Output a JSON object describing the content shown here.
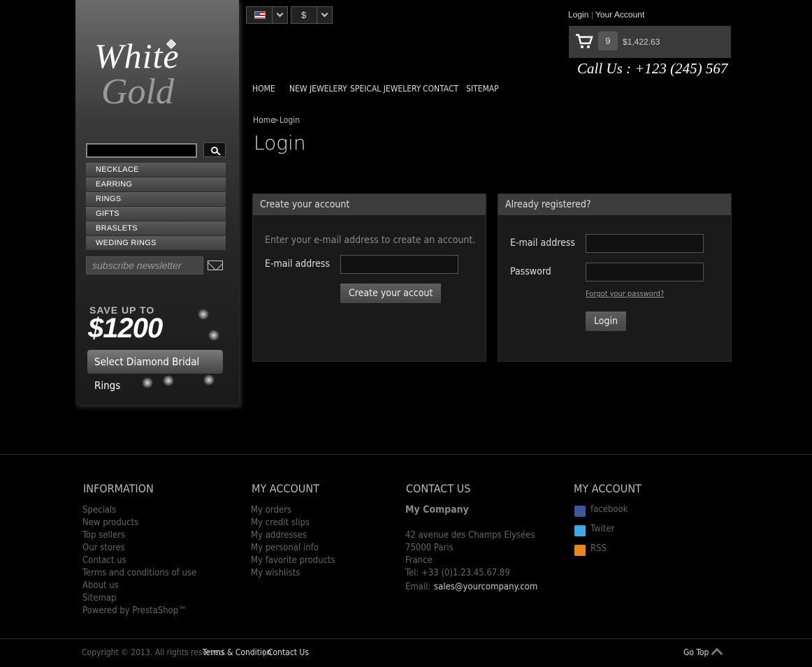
{
  "logo": {
    "line1": "White",
    "line2": "Gold"
  },
  "sidebar": {
    "categories": [
      "NECKLACE",
      "EARRING",
      "RINGS",
      "GIFTS",
      "BRASLETS",
      "WEDING RINGS"
    ],
    "newsletter_placeholder": "subscribe newsletter",
    "promo": {
      "save": "SAVE UP TO",
      "amount": "$1200",
      "button": "Select Diamond Bridal Rings"
    }
  },
  "topbar": {
    "currency": "$",
    "login": "Login",
    "separator": "|",
    "account": "Your Account",
    "cart_count": "9",
    "cart_total": "$1,422.63",
    "phone": "Call Us : +123 (245) 567"
  },
  "nav": [
    "HOME",
    "NEW JEWELERY",
    "SPEICAL JEWELERY",
    "CONTACT",
    "SITEMAP"
  ],
  "breadcrumb": {
    "home": "Home",
    "sep": ">",
    "current": "Login"
  },
  "page": {
    "title": "Login",
    "create": {
      "heading": "Create your  account",
      "intro": "Enter your e-mail address to create an account.",
      "email_label": "E-mail address",
      "button": "Create your accout"
    },
    "registered": {
      "heading": "Already registered?",
      "email_label": "E-mail address",
      "password_label": "Password",
      "forgot": "Forgot your password?",
      "button": "Login"
    }
  },
  "footer": {
    "information": {
      "heading": "INFORMATION",
      "links": [
        "Specials",
        "New products",
        "Top sellers",
        "Our stores",
        "Contact us",
        "Terms and conditions of use",
        "About us",
        "Sitemap",
        "Powered by PrestaShop™"
      ]
    },
    "account": {
      "heading": "MY ACCOUNT",
      "links": [
        "My orders",
        "My credit slips",
        "My addresses",
        "My personal info",
        "My favorite products",
        "My wishlists"
      ]
    },
    "contact": {
      "heading": "CONTACT US",
      "company": "My Company",
      "street": "42 avenue des Champs Elysées",
      "city": "75000 Paris",
      "country": "France",
      "tel": "Tel: +33 (0)1.23.45.67.89",
      "email_label": "Email:",
      "email": "sales@yourcompany.com"
    },
    "social": {
      "heading": "MY ACCOUNT",
      "links": [
        "facebook",
        "Twiter",
        "RSS"
      ]
    },
    "copyright": "Copyright © 2013. All rights reserved.",
    "terms": "Terms & Condition",
    "separator": "|",
    "contact_us": "Contact Us",
    "go_top": "Go Top"
  },
  "colors": {
    "background": "#000000",
    "panel": "#1a1a1a",
    "panel_head": "#3c3c3c",
    "cart_box": "#3a3a3a"
  }
}
